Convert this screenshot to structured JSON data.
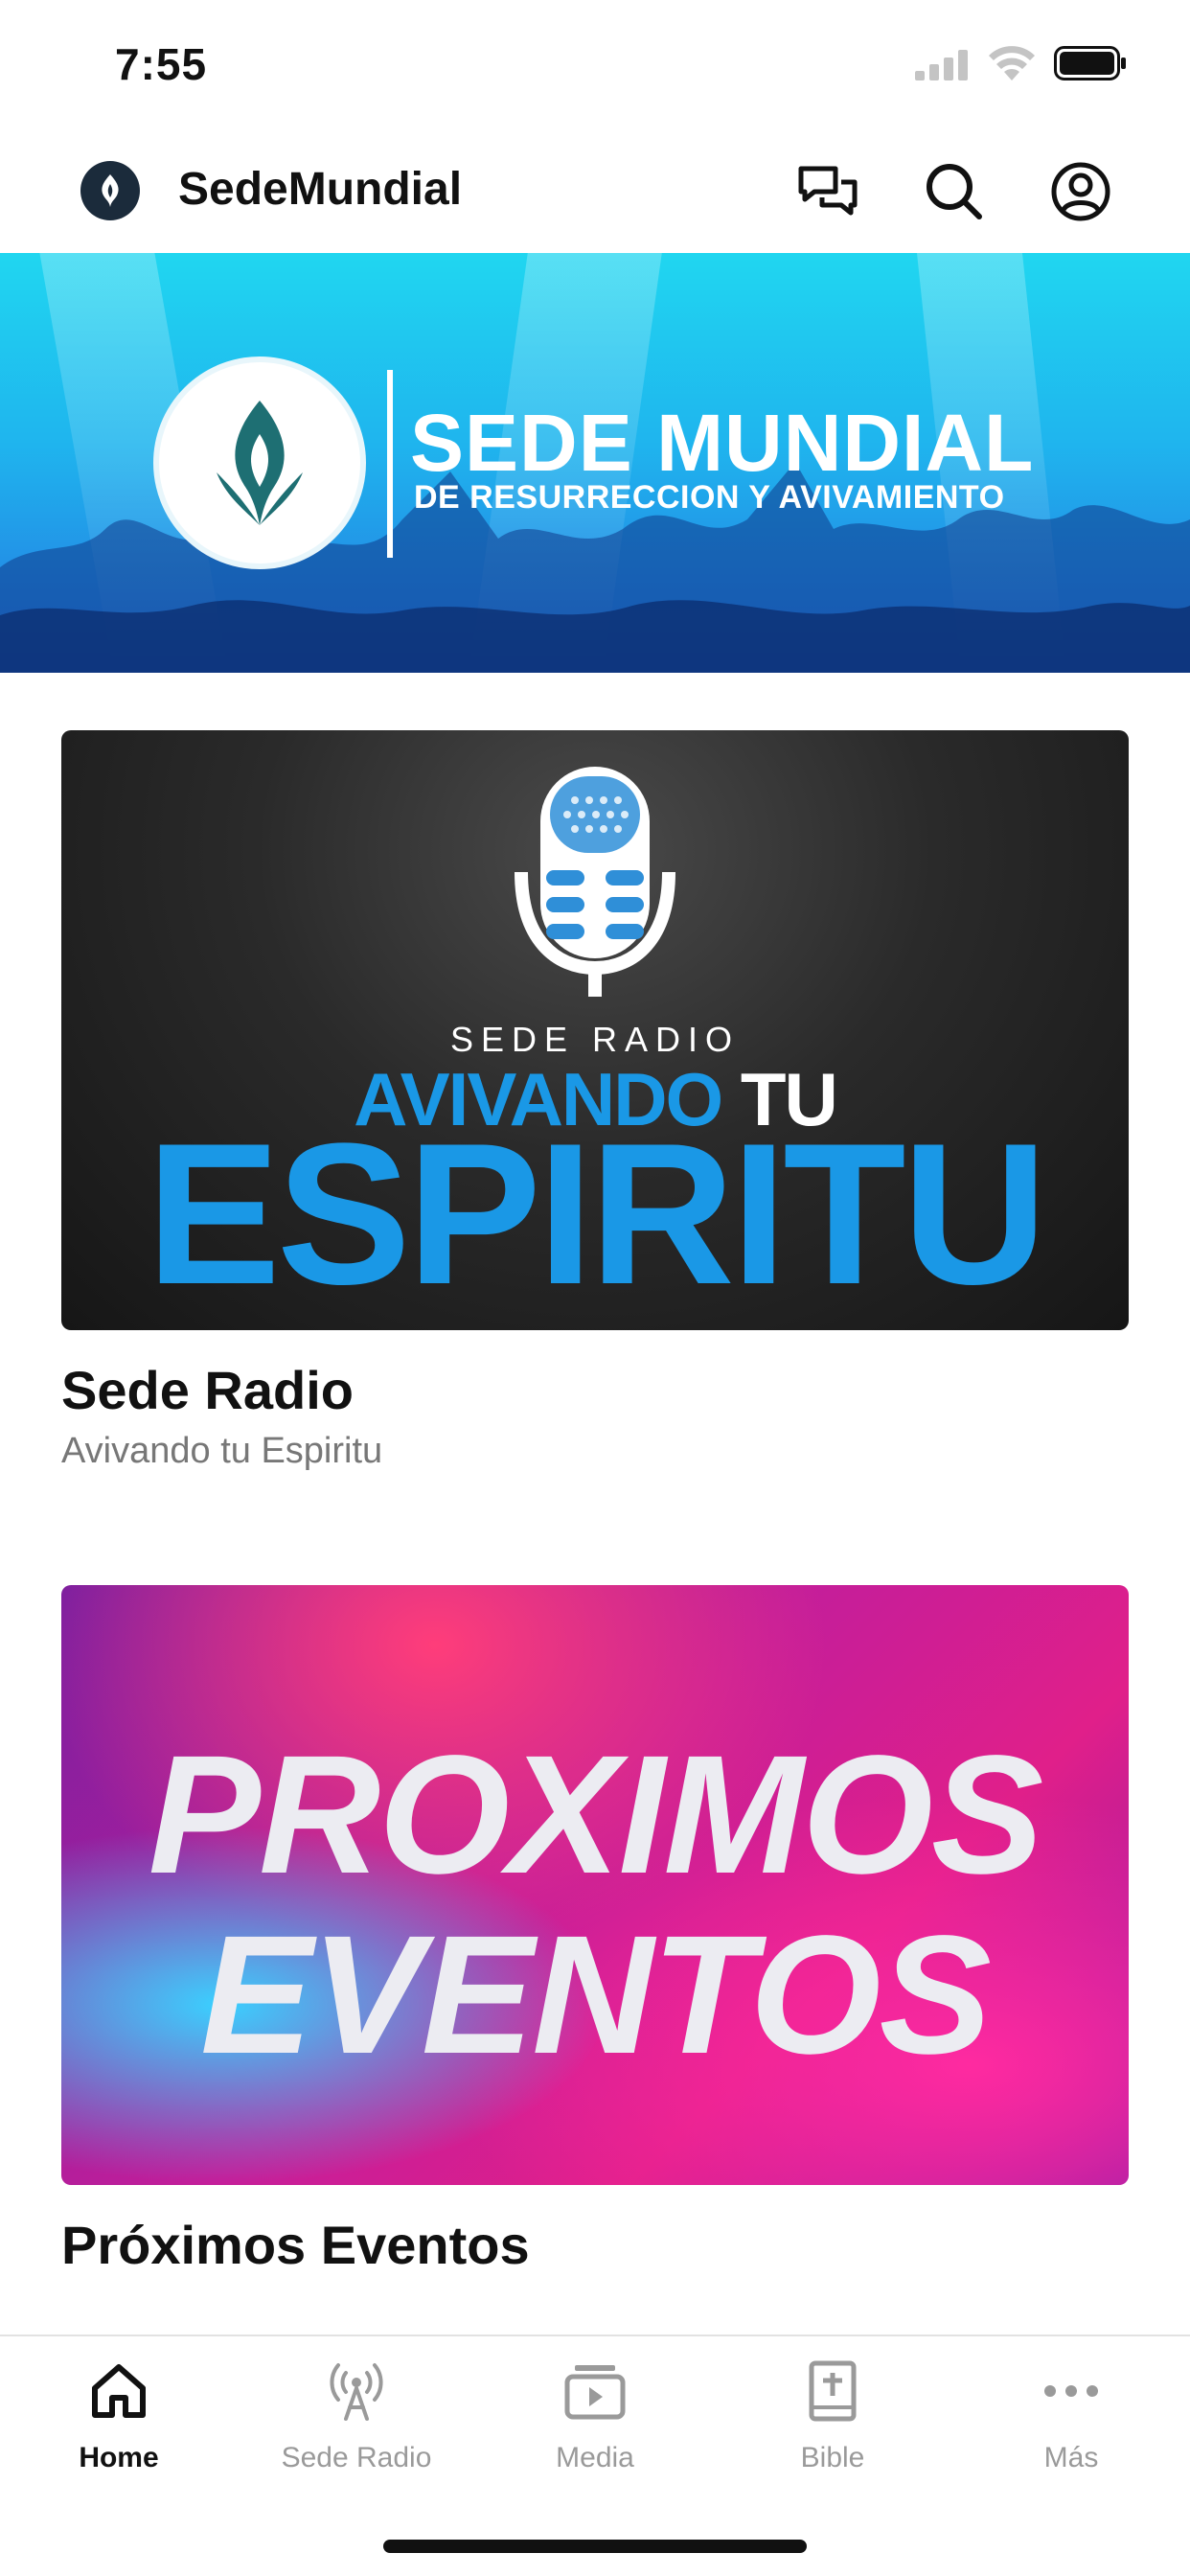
{
  "status_bar": {
    "time": "7:55"
  },
  "header": {
    "app_name": "SedeMundial",
    "icons": [
      "chat-icon",
      "search-icon",
      "account-icon"
    ]
  },
  "hero": {
    "title": "SEDE MUNDIAL",
    "subtitle": "DE RESURRECCION Y AVIVAMIENTO"
  },
  "cards": [
    {
      "image_text": {
        "label": "SEDE RADIO",
        "line1_blue": "AVIVANDO",
        "line1_white": "TU",
        "line2": "ESPIRITU"
      },
      "title": "Sede Radio",
      "subtitle": "Avivando tu Espiritu"
    },
    {
      "image_text": {
        "line1": "PROXIMOS",
        "line2": "EVENTOS"
      },
      "title": "Próximos Eventos"
    }
  ],
  "tabs": [
    {
      "label": "Home",
      "icon": "home-icon",
      "active": true
    },
    {
      "label": "Sede Radio",
      "icon": "radio-tower-icon",
      "active": false
    },
    {
      "label": "Media",
      "icon": "media-icon",
      "active": false
    },
    {
      "label": "Bible",
      "icon": "bible-icon",
      "active": false
    },
    {
      "label": "Más",
      "icon": "more-icon",
      "active": false
    }
  ],
  "colors": {
    "accent_blue": "#1a98e6",
    "hero_cyan": "#20d6f0",
    "events_magenta": "#c41e9a"
  }
}
